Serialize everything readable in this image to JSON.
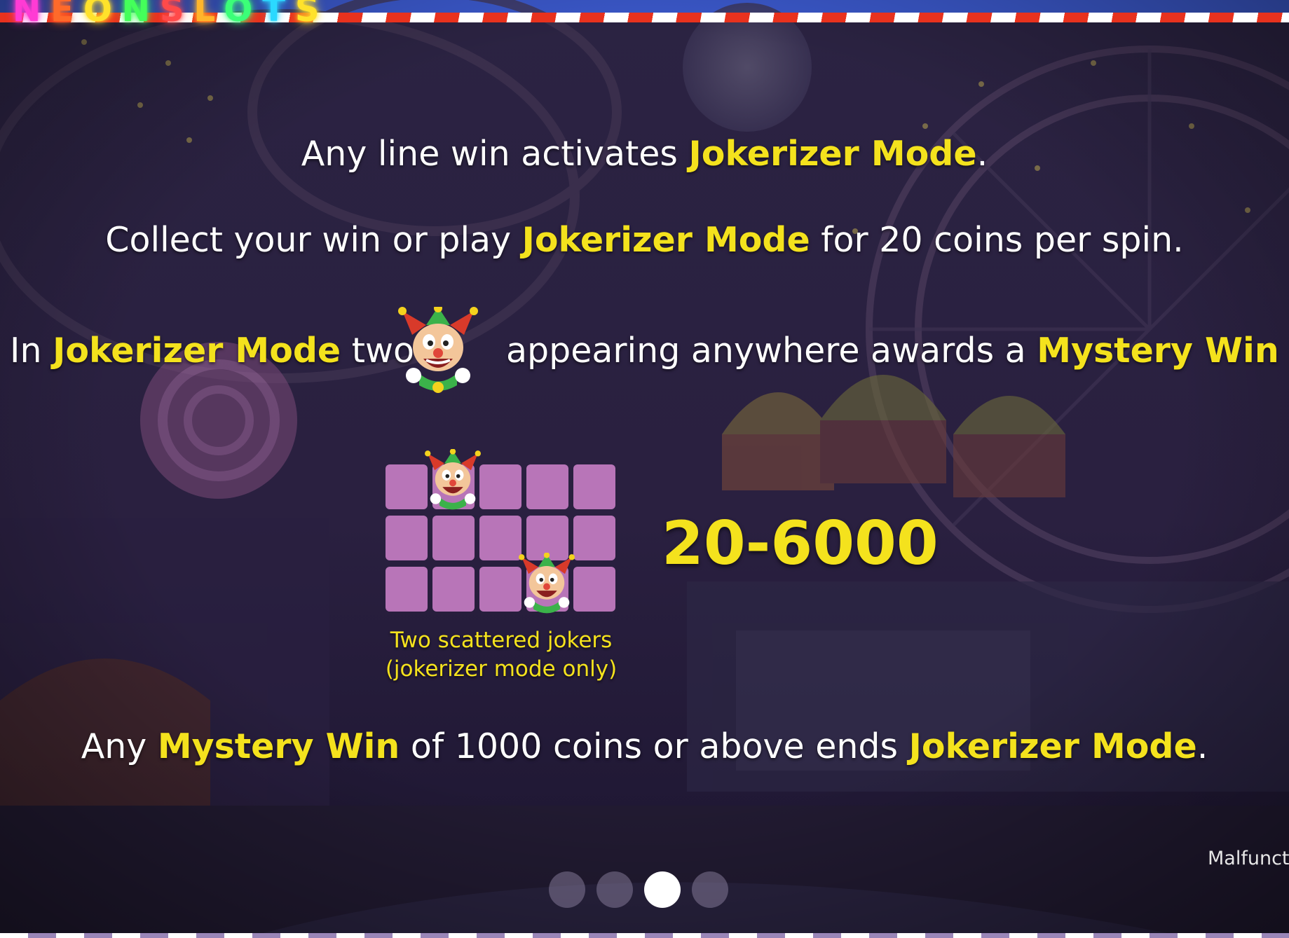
{
  "game": {
    "logo_letters": [
      "N",
      "E",
      "O",
      "N",
      "S",
      "L",
      "O",
      "T",
      "S"
    ],
    "logo_colors": [
      "#ff3bd4",
      "#ff6a2a",
      "#ffe22b",
      "#44ff5a",
      "#ff4a4a",
      "#ffb52b",
      "#3bff78",
      "#2bd9ff",
      "#ffe22b"
    ]
  },
  "rules": {
    "line1": {
      "pre": "Any line win activates ",
      "hl": "Jokerizer Mode",
      "post": "."
    },
    "line2": {
      "pre": "Collect your win or play ",
      "hl": "Jokerizer Mode",
      "post": " for 20 coins per spin."
    },
    "line3": {
      "pre": "In ",
      "hl1": "Jokerizer Mode",
      "mid": " two",
      "after_icon": "appearing anywhere awards a ",
      "hl2": "Mystery Win"
    },
    "line4": {
      "pre": "Any ",
      "hl1": "Mystery Win",
      "mid": " of 1000 coins or above ends ",
      "hl2": "Jokerizer Mode",
      "post": "."
    }
  },
  "payout": {
    "range": "20-6000",
    "caption_line1": "Two scattered jokers",
    "caption_line2": "(jokerizer mode only)"
  },
  "footer": {
    "malfunction_text": "Malfunct"
  },
  "pagination": {
    "total_pages": 4,
    "current_page": 3
  },
  "icons": {
    "symbol": "joker-icon"
  },
  "colors": {
    "highlight": "#f4e21d",
    "text": "#ffffff",
    "grid_cell": "#c47dc2",
    "background": "#241b3c"
  }
}
